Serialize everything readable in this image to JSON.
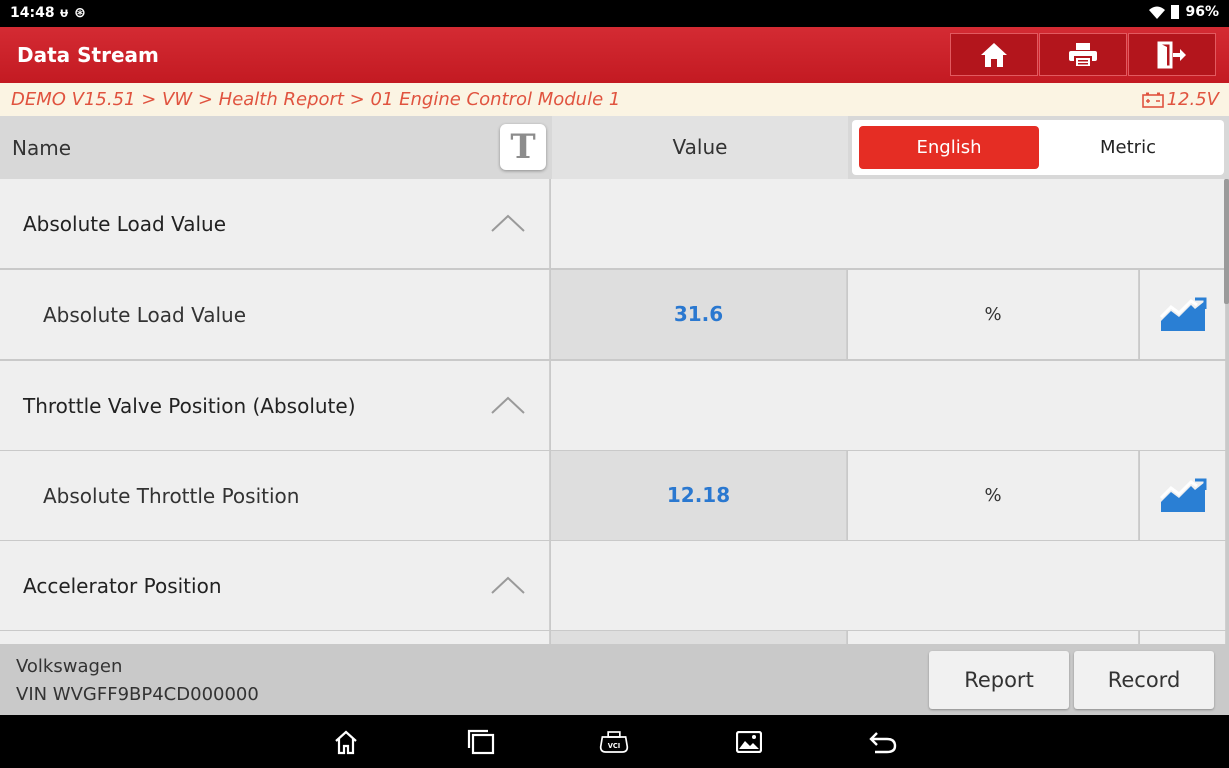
{
  "status": {
    "time": "14:48",
    "battery": "96%"
  },
  "header": {
    "title": "Data Stream"
  },
  "breadcrumb": {
    "path": "DEMO V15.51 > VW > Health Report > 01 Engine Control Module 1",
    "voltage": "12.5V"
  },
  "table_header": {
    "name": "Name",
    "t_button": "T",
    "value": "Value",
    "unit_options": [
      "English",
      "Metric"
    ],
    "selected_unit": "English"
  },
  "rows": [
    {
      "group": "Absolute Load Value",
      "item": {
        "name": "Absolute Load Value",
        "value": "31.6",
        "unit": "%"
      }
    },
    {
      "group": "Throttle Valve Position (Absolute)",
      "item": {
        "name": "Absolute Throttle Position",
        "value": "12.18",
        "unit": "%"
      }
    },
    {
      "group": "Accelerator Position"
    }
  ],
  "footer": {
    "make": "Volkswagen",
    "vin": "VIN WVGFF9BP4CD000000",
    "report": "Report",
    "record": "Record"
  },
  "colors": {
    "header_red": "#c31a22",
    "accent_red": "#e52d24",
    "value_blue": "#2a78d0",
    "crumb_text": "#e0533f"
  }
}
